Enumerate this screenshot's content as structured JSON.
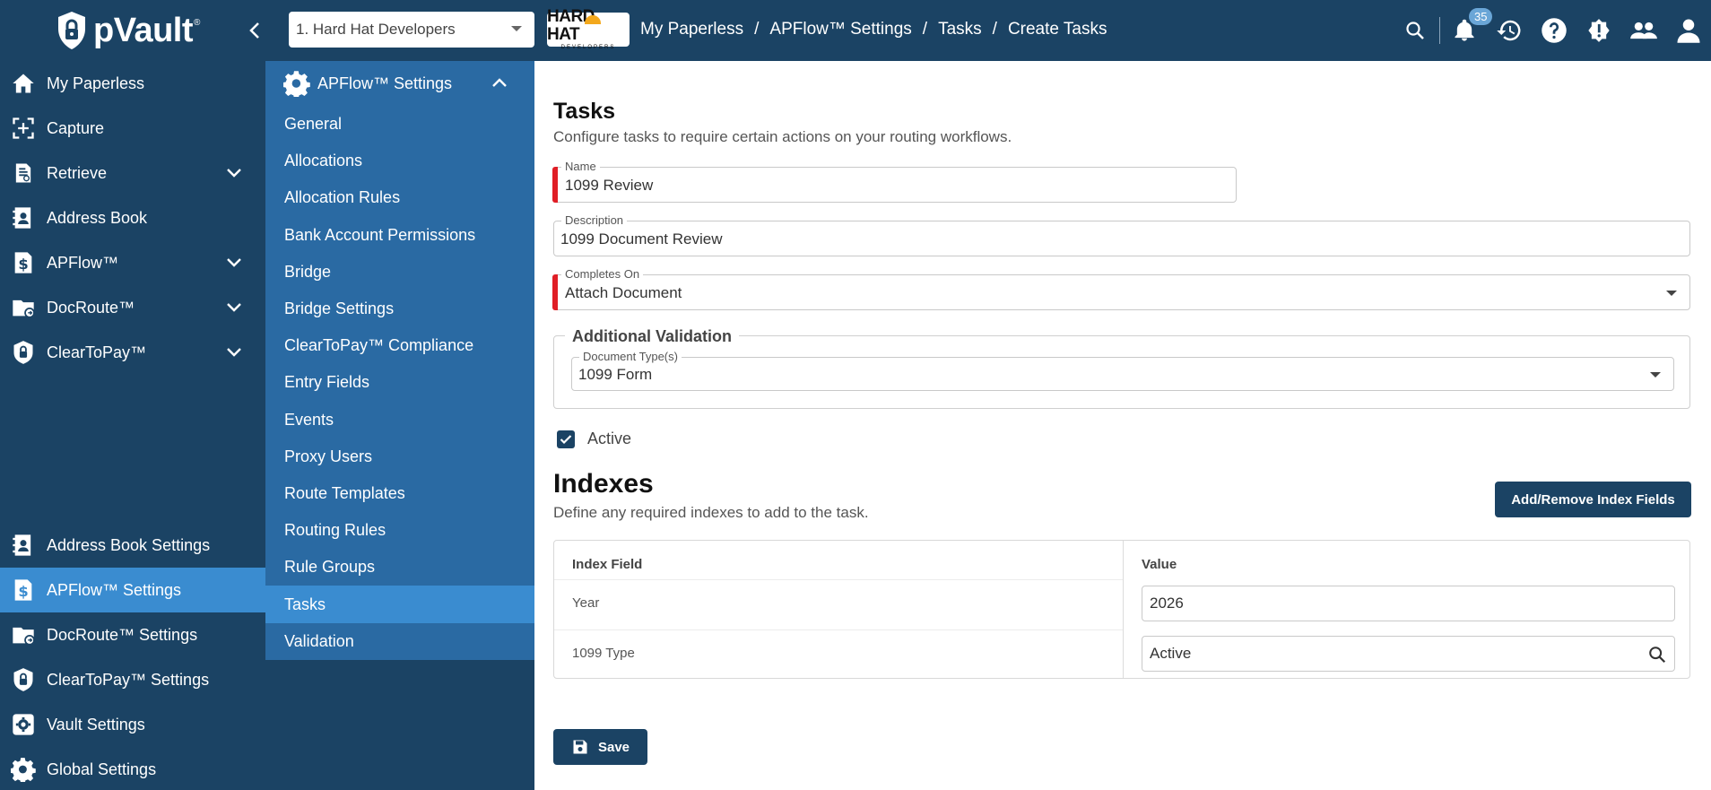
{
  "app": {
    "name": "pVault",
    "trademark": "®"
  },
  "topbar": {
    "org_select": "1. Hard Hat Developers",
    "brand_logo": {
      "line1": "HARD HAT",
      "line2": "DEVELOPERS"
    },
    "breadcrumb": [
      "My Paperless",
      "APFlow™ Settings",
      "Tasks",
      "Create Tasks"
    ],
    "breadcrumb_sep": "/",
    "notification_count": "35",
    "icons": [
      "search-icon",
      "bell-icon",
      "history-icon",
      "help-icon",
      "alert-icon",
      "users-icon",
      "account-icon"
    ]
  },
  "leftnav": {
    "items": [
      {
        "label": "My Paperless",
        "icon": "home-icon"
      },
      {
        "label": "Capture",
        "icon": "capture-icon"
      },
      {
        "label": "Retrieve",
        "icon": "retrieve-icon",
        "expandable": true
      },
      {
        "label": "Address Book",
        "icon": "address-book-icon"
      },
      {
        "label": "APFlow™",
        "icon": "dollar-doc-icon",
        "expandable": true
      },
      {
        "label": "DocRoute™",
        "icon": "folder-route-icon",
        "expandable": true
      },
      {
        "label": "ClearToPay™",
        "icon": "shield-lock-icon",
        "expandable": true
      }
    ],
    "settings": [
      {
        "label": "Address Book Settings",
        "icon": "address-book-icon"
      },
      {
        "label": "APFlow™ Settings",
        "icon": "dollar-doc-icon",
        "active": true
      },
      {
        "label": "DocRoute™ Settings",
        "icon": "folder-route-icon"
      },
      {
        "label": "ClearToPay™ Settings",
        "icon": "shield-lock-icon"
      },
      {
        "label": "Vault Settings",
        "icon": "gear-box-icon"
      },
      {
        "label": "Global Settings",
        "icon": "gear-icon"
      }
    ]
  },
  "subnav": {
    "title": "APFlow™ Settings",
    "items": [
      "General",
      "Allocations",
      "Allocation Rules",
      "Bank Account Permissions",
      "Bridge",
      "Bridge Settings",
      "ClearToPay™ Compliance",
      "Entry Fields",
      "Events",
      "Proxy Users",
      "Route Templates",
      "Routing Rules",
      "Rule Groups",
      "Tasks",
      "Validation"
    ],
    "active": "Tasks"
  },
  "main": {
    "title": "Tasks",
    "subtitle": "Configure tasks to require certain actions on your routing workflows.",
    "name_label": "Name",
    "name_value": "1099 Review",
    "description_label": "Description",
    "description_value": "1099 Document Review",
    "completes_on_label": "Completes On",
    "completes_on_value": "Attach Document",
    "additional_validation_legend": "Additional Validation",
    "doc_types_label": "Document Type(s)",
    "doc_types_value": "1099 Form",
    "active_label": "Active",
    "active_checked": true,
    "indexes_title": "Indexes",
    "indexes_subtitle": "Define any required indexes to add to the task.",
    "add_remove_button": "Add/Remove Index Fields",
    "table": {
      "headers": [
        "Index Field",
        "Value"
      ],
      "rows": [
        {
          "field": "Year",
          "value": "2026"
        },
        {
          "field": "1099 Type",
          "value": "Active"
        }
      ]
    },
    "save_button": "Save"
  }
}
